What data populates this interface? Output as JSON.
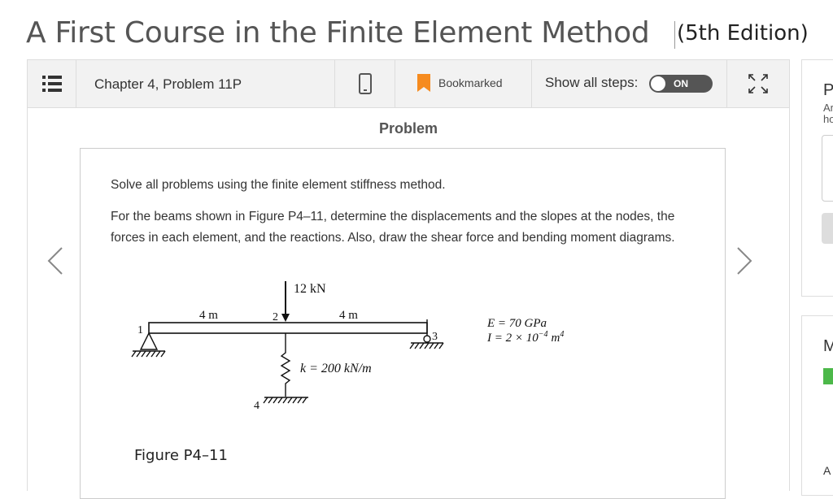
{
  "header": {
    "book_title": "A First Course in the Finite Element Method",
    "edition": "(5th Edition)"
  },
  "toolbar": {
    "chapter_label": "Chapter 4, Problem 11P",
    "bookmark_label": "Bookmarked",
    "show_steps_label": "Show all steps:",
    "toggle_state": "ON",
    "accent_color": "#f68b1f"
  },
  "problem": {
    "heading": "Problem",
    "instruction": "Solve all problems using the finite element stiffness method.",
    "text": "For the beams shown in Figure P4–11, determine the displacements and the slopes at the nodes, the forces in each element, and the reactions. Also, draw the shear force and bending moment diagrams."
  },
  "figure": {
    "load": "12 kN",
    "span_left": "4 m",
    "span_right": "4 m",
    "node_1": "1",
    "node_2": "2",
    "node_3": "3",
    "node_4": "4",
    "spring": "k = 200 kN/m",
    "modulus": "E = 70 GPa",
    "inertia": "I = 2 × 10",
    "inertia_exp": "−4",
    "inertia_unit": "m",
    "inertia_unit_exp": "4",
    "caption": "Figure P4–11"
  },
  "right_panel": {
    "heading_1": "P",
    "sub_1": "Ar",
    "sub_2": "ho",
    "heading_2": "M",
    "footer": "A"
  }
}
